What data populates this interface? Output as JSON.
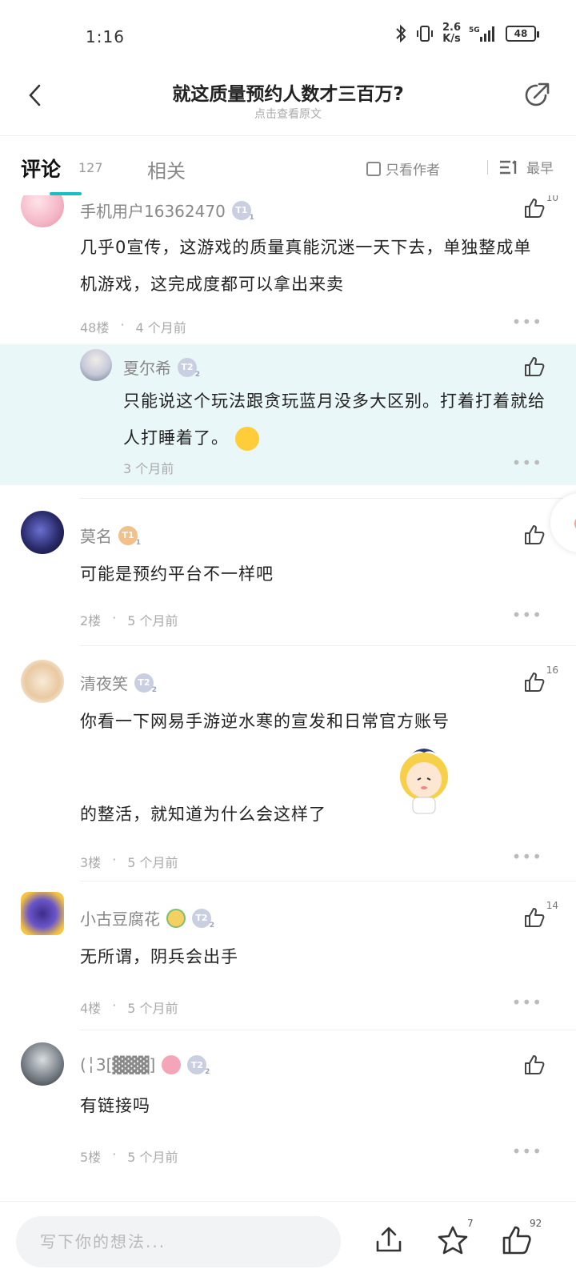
{
  "status_bar": {
    "time": "1:16",
    "net_speed_top": "2.6",
    "net_speed_bottom": "K/s",
    "network": "5G",
    "battery": "48"
  },
  "header": {
    "title": "就这质量预约人数才三百万?",
    "subtitle": "点击查看原文"
  },
  "tabs": {
    "comments_label": "评论",
    "comments_count": "127",
    "related_label": "相关",
    "author_only_label": "只看作者",
    "sort_label": "最早"
  },
  "comments": [
    {
      "username": "手机用户16362470",
      "level": "T1",
      "text": "几乎0宣传，这游戏的质量真能沉迷一天下去，单独整成单机游戏，这完成度都可以拿出来卖",
      "floor": "48楼",
      "time": "4 个月前",
      "likes": "10",
      "reply": {
        "username": "夏尔希",
        "level": "T2",
        "text": "只能说这个玩法跟贪玩蓝月没多大区别。打着打着就给人打睡着了。",
        "time": "3 个月前"
      }
    },
    {
      "username": "莫名",
      "level": "T1",
      "text": "可能是预约平台不一样吧",
      "floor": "2楼",
      "time": "5 个月前",
      "likes": ""
    },
    {
      "username": "清夜笑",
      "level": "T2",
      "text_line1": "你看一下网易手游逆水寒的宣发和日常官方账号",
      "text_line2": "的整活，就知道为什么会这样了",
      "floor": "3楼",
      "time": "5 个月前",
      "likes": "16"
    },
    {
      "username": "小古豆腐花",
      "level": "T2",
      "text": "无所谓，阴兵会出手",
      "floor": "4楼",
      "time": "5 个月前",
      "likes": "14"
    },
    {
      "username": "(╎3[▓▓▓]",
      "level": "T2",
      "text": "有链接吗",
      "floor": "5楼",
      "time": "5 个月前",
      "likes": ""
    }
  ],
  "bottom_bar": {
    "input_placeholder": "写下你的想法...",
    "favorite_count": "7",
    "like_count": "92"
  },
  "colors": {
    "accent": "#14c0c5",
    "reply_bg": "#e9f7f8"
  }
}
